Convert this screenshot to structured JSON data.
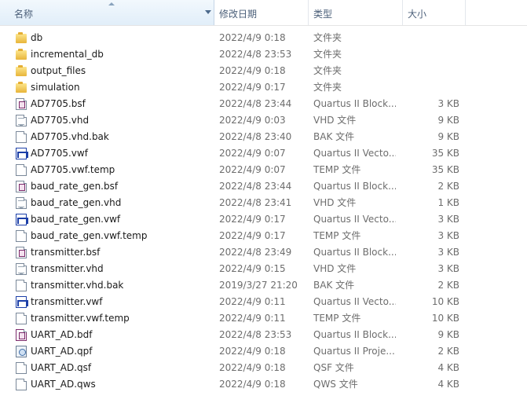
{
  "columns": {
    "name": "名称",
    "date": "修改日期",
    "type": "类型",
    "size": "大小"
  },
  "files": [
    {
      "icon": "folder-icon",
      "kind": "folder",
      "name": "db",
      "date": "2022/4/9 0:18",
      "type": "文件夹",
      "size": ""
    },
    {
      "icon": "folder-icon",
      "kind": "folder",
      "name": "incremental_db",
      "date": "2022/4/8 23:53",
      "type": "文件夹",
      "size": ""
    },
    {
      "icon": "folder-icon",
      "kind": "folder",
      "name": "output_files",
      "date": "2022/4/9 0:18",
      "type": "文件夹",
      "size": ""
    },
    {
      "icon": "folder-icon",
      "kind": "folder",
      "name": "simulation",
      "date": "2022/4/9 0:17",
      "type": "文件夹",
      "size": ""
    },
    {
      "icon": "block-symbol-file-icon",
      "kind": "bsf",
      "name": "AD7705.bsf",
      "date": "2022/4/8 23:44",
      "type": "Quartus II Block...",
      "size": "3 KB"
    },
    {
      "icon": "vhd-file-icon",
      "kind": "vhd",
      "name": "AD7705.vhd",
      "date": "2022/4/9 0:03",
      "type": "VHD 文件",
      "size": "9 KB"
    },
    {
      "icon": "blank-file-icon",
      "kind": "blank",
      "name": "AD7705.vhd.bak",
      "date": "2022/4/8 23:40",
      "type": "BAK 文件",
      "size": "9 KB"
    },
    {
      "icon": "waveform-file-icon",
      "kind": "vwf",
      "name": "AD7705.vwf",
      "date": "2022/4/9 0:07",
      "type": "Quartus II Vecto...",
      "size": "35 KB"
    },
    {
      "icon": "blank-file-icon",
      "kind": "blank",
      "name": "AD7705.vwf.temp",
      "date": "2022/4/9 0:07",
      "type": "TEMP 文件",
      "size": "35 KB"
    },
    {
      "icon": "block-symbol-file-icon",
      "kind": "bsf",
      "name": "baud_rate_gen.bsf",
      "date": "2022/4/8 23:44",
      "type": "Quartus II Block...",
      "size": "2 KB"
    },
    {
      "icon": "vhd-file-icon",
      "kind": "vhd",
      "name": "baud_rate_gen.vhd",
      "date": "2022/4/8 23:41",
      "type": "VHD 文件",
      "size": "1 KB"
    },
    {
      "icon": "waveform-file-icon",
      "kind": "vwf",
      "name": "baud_rate_gen.vwf",
      "date": "2022/4/9 0:17",
      "type": "Quartus II Vecto...",
      "size": "3 KB"
    },
    {
      "icon": "blank-file-icon",
      "kind": "blank",
      "name": "baud_rate_gen.vwf.temp",
      "date": "2022/4/9 0:17",
      "type": "TEMP 文件",
      "size": "3 KB"
    },
    {
      "icon": "block-symbol-file-icon",
      "kind": "bsf",
      "name": "transmitter.bsf",
      "date": "2022/4/8 23:49",
      "type": "Quartus II Block...",
      "size": "3 KB"
    },
    {
      "icon": "vhd-file-icon",
      "kind": "vhd",
      "name": "transmitter.vhd",
      "date": "2022/4/9 0:15",
      "type": "VHD 文件",
      "size": "3 KB"
    },
    {
      "icon": "blank-file-icon",
      "kind": "blank",
      "name": "transmitter.vhd.bak",
      "date": "2019/3/27 21:20",
      "type": "BAK 文件",
      "size": "2 KB"
    },
    {
      "icon": "waveform-file-icon",
      "kind": "vwf",
      "name": "transmitter.vwf",
      "date": "2022/4/9 0:11",
      "type": "Quartus II Vecto...",
      "size": "10 KB"
    },
    {
      "icon": "blank-file-icon",
      "kind": "blank",
      "name": "transmitter.vwf.temp",
      "date": "2022/4/9 0:11",
      "type": "TEMP 文件",
      "size": "10 KB"
    },
    {
      "icon": "block-diagram-file-icon",
      "kind": "bdf",
      "name": "UART_AD.bdf",
      "date": "2022/4/8 23:53",
      "type": "Quartus II Block...",
      "size": "9 KB"
    },
    {
      "icon": "project-file-icon",
      "kind": "qpf",
      "name": "UART_AD.qpf",
      "date": "2022/4/9 0:18",
      "type": "Quartus II Proje...",
      "size": "2 KB"
    },
    {
      "icon": "blank-file-icon",
      "kind": "blank",
      "name": "UART_AD.qsf",
      "date": "2022/4/9 0:18",
      "type": "QSF 文件",
      "size": "4 KB"
    },
    {
      "icon": "blank-file-icon",
      "kind": "blank",
      "name": "UART_AD.qws",
      "date": "2022/4/9 0:18",
      "type": "QWS 文件",
      "size": "4 KB"
    }
  ]
}
